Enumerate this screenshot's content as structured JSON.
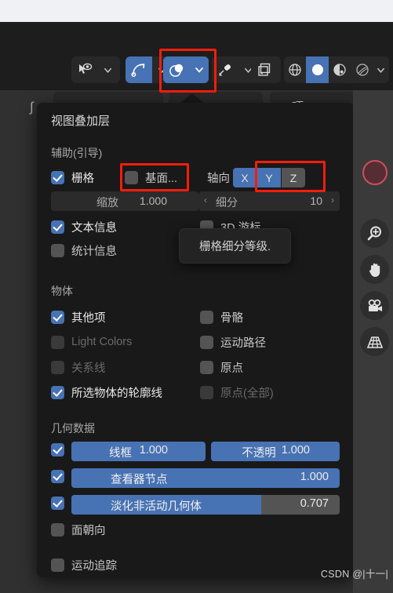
{
  "toolbar": {
    "groups": [
      {
        "name": "visibility",
        "icons": [
          "cursor-eye-icon",
          "chevron-down-icon"
        ]
      },
      {
        "name": "snap",
        "icons": [
          "snap-magnet-icon",
          "chevron-down-icon"
        ]
      },
      {
        "name": "overlays",
        "icons": [
          "overlays-icon",
          "chevron-down-icon"
        ]
      },
      {
        "name": "xray",
        "icons": [
          "xray-icon",
          "chevron-down-icon"
        ]
      },
      {
        "name": "render-region",
        "icons": [
          "render-region-icon"
        ]
      },
      {
        "name": "shading",
        "icons": [
          "wireframe-globe-icon",
          "solid-sphere-icon",
          "material-preview-icon",
          "rendered-icon",
          "chevron-down-icon"
        ]
      }
    ]
  },
  "header": {
    "options_label": "项",
    "options_caret": "chevron-down-icon"
  },
  "popup": {
    "title": "视图叠加层",
    "sections": {
      "guides": {
        "heading": "辅助(引导)",
        "grid": {
          "label": "栅格",
          "checked": true
        },
        "floor": {
          "label": "基面...",
          "checked": false
        },
        "axes_label": "轴向",
        "axes": [
          {
            "label": "X",
            "active": true
          },
          {
            "label": "Y",
            "active": true
          },
          {
            "label": "Z",
            "active": false
          }
        ],
        "scale": {
          "label": "缩放",
          "value": "1.000"
        },
        "subdivision": {
          "label": "细分",
          "value": "10",
          "left_arrow": "‹",
          "right_arrow": "›"
        },
        "text_info": {
          "label": "文本信息",
          "checked": true
        },
        "statistics": {
          "label": "统计信息",
          "checked": false
        },
        "cursor_3d": {
          "label": "3D 游标",
          "checked": false
        }
      },
      "object": {
        "heading": "物体",
        "items": [
          {
            "label": "其他项",
            "checked": true,
            "dim": false
          },
          {
            "label": "骨骼",
            "checked": false,
            "dim": false
          },
          {
            "label": "Light Colors",
            "checked": false,
            "dim": true
          },
          {
            "label": "运动路径",
            "checked": false,
            "dim": false
          },
          {
            "label": "关系线",
            "checked": false,
            "dim": true
          },
          {
            "label": "原点",
            "checked": false,
            "dim": false
          },
          {
            "label": "所选物体的轮廓线",
            "checked": true,
            "dim": false
          },
          {
            "label": "原点(全部)",
            "checked": false,
            "dim": true
          }
        ]
      },
      "geometry": {
        "heading": "几何数据",
        "rows": [
          {
            "label": "线框",
            "value": "1.000",
            "checked": true,
            "fill_pct": 100
          },
          {
            "label": "不透明",
            "value": "1.000",
            "checked": null,
            "fill_pct": 100
          },
          {
            "label": "查看器节点",
            "value": "1.000",
            "checked": true,
            "fill_pct": 100
          },
          {
            "label": "淡化非活动几何体",
            "value": "0.707",
            "checked": true,
            "fill_pct": 70.7
          }
        ],
        "face_orientation": {
          "label": "面朝向",
          "checked": false
        },
        "motion_tracking": {
          "label": "运动追踪",
          "checked": false
        }
      }
    }
  },
  "tooltip": {
    "text": "栅格细分等级."
  },
  "gizmos": {
    "navigation_ball": "navigation-gizmo",
    "buttons": [
      {
        "name": "zoom-icon"
      },
      {
        "name": "pan-hand-icon"
      },
      {
        "name": "camera-icon"
      },
      {
        "name": "grid-perspective-icon"
      }
    ]
  },
  "watermark": {
    "text": "CSDN @|十一|"
  },
  "colors": {
    "accent": "#4772b3",
    "annotation": "#f41d0c",
    "panel_bg": "#191919"
  }
}
